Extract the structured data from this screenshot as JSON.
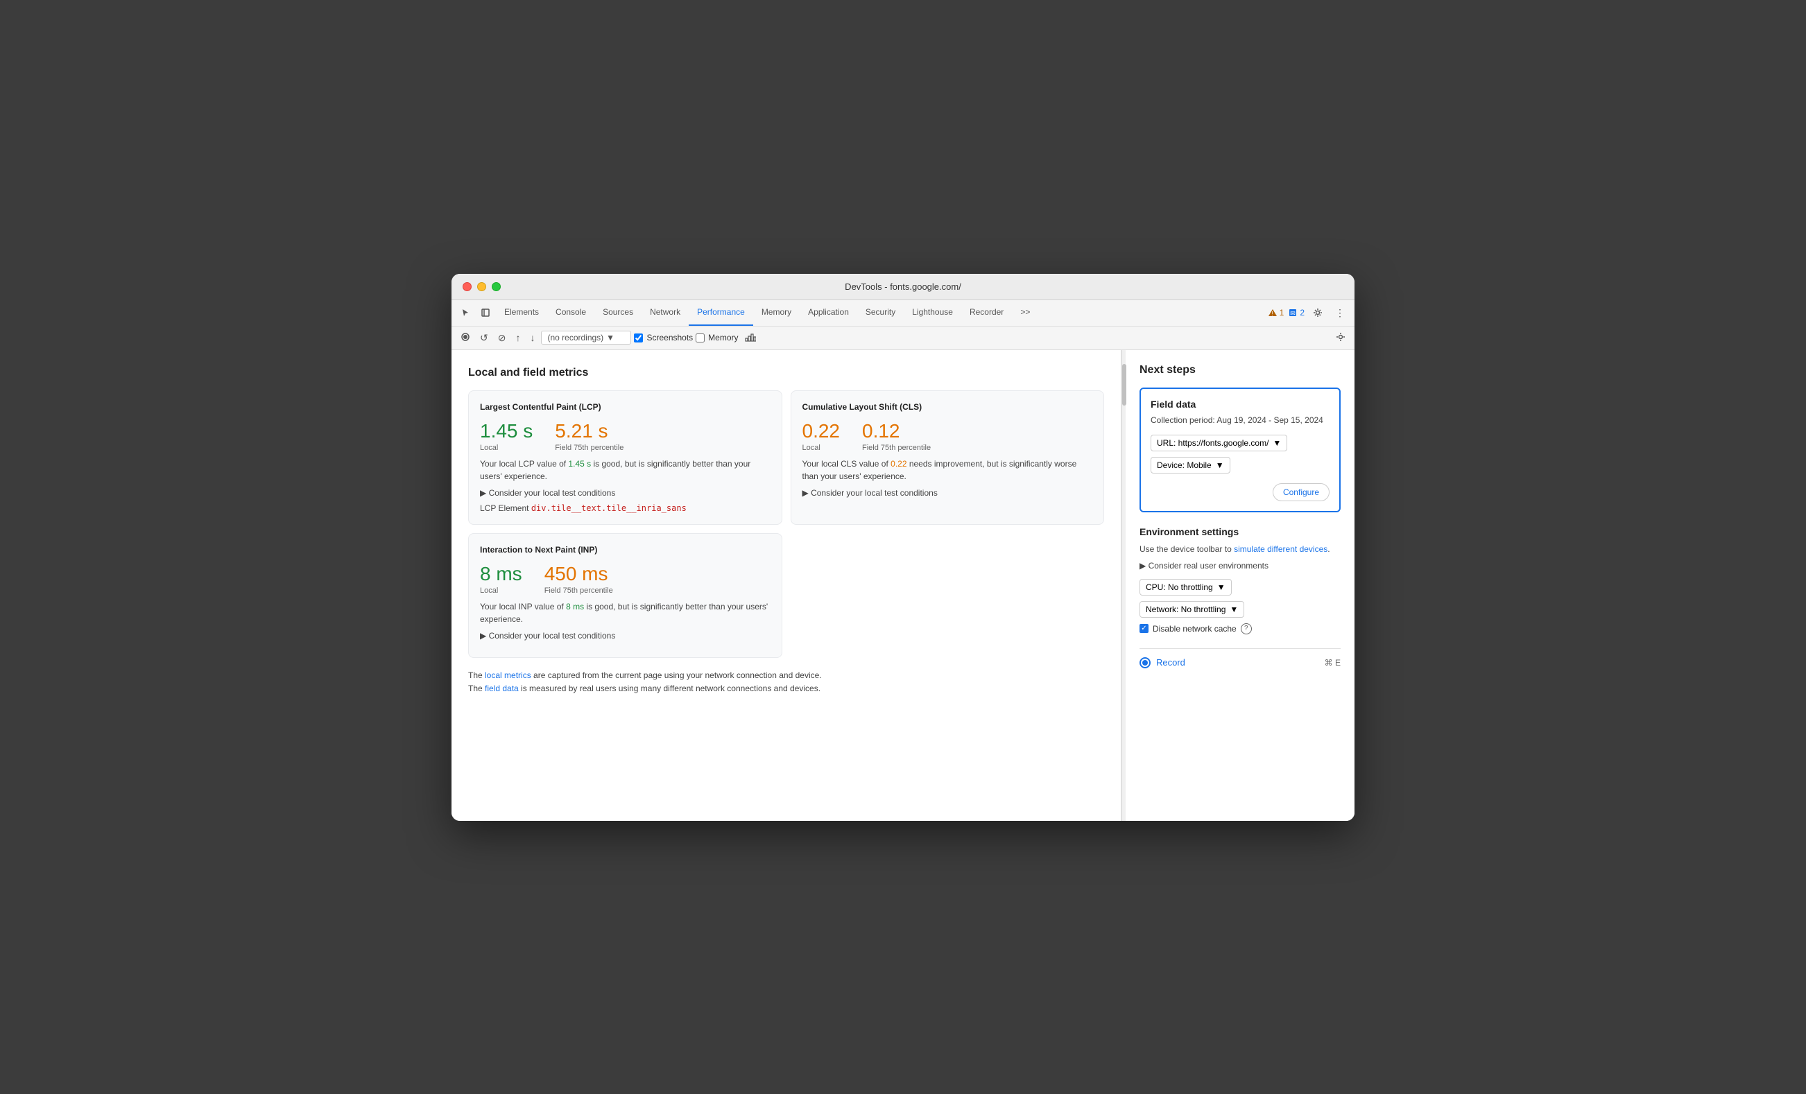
{
  "window": {
    "title": "DevTools - fonts.google.com/"
  },
  "tabs": [
    {
      "id": "elements",
      "label": "Elements",
      "active": false
    },
    {
      "id": "console",
      "label": "Console",
      "active": false
    },
    {
      "id": "sources",
      "label": "Sources",
      "active": false
    },
    {
      "id": "network",
      "label": "Network",
      "active": false
    },
    {
      "id": "performance",
      "label": "Performance",
      "active": true
    },
    {
      "id": "memory",
      "label": "Memory",
      "active": false
    },
    {
      "id": "application",
      "label": "Application",
      "active": false
    },
    {
      "id": "security",
      "label": "Security",
      "active": false
    },
    {
      "id": "lighthouse",
      "label": "Lighthouse",
      "active": false
    },
    {
      "id": "recorder",
      "label": "Recorder",
      "active": false
    }
  ],
  "toolbar_right": {
    "warning_count": "1",
    "info_count": "2"
  },
  "secondary_toolbar": {
    "recording_placeholder": "(no recordings)",
    "screenshots_label": "Screenshots",
    "memory_label": "Memory",
    "screenshots_checked": true,
    "memory_checked": false
  },
  "left_panel": {
    "section_title": "Local and field metrics",
    "lcp_card": {
      "title": "Largest Contentful Paint (LCP)",
      "local_value": "1.45 s",
      "local_label": "Local",
      "field_value": "5.21 s",
      "field_label": "Field 75th percentile",
      "description_prefix": "Your local LCP value of ",
      "description_local": "1.45 s",
      "description_mid": " is good, but is significantly better than your users' experience.",
      "consider_label": "▶ Consider your local test conditions",
      "lcp_element_label": "LCP Element",
      "lcp_element_value": "div.tile__text.tile__inria_sans"
    },
    "cls_card": {
      "title": "Cumulative Layout Shift (CLS)",
      "local_value": "0.22",
      "local_label": "Local",
      "field_value": "0.12",
      "field_label": "Field 75th percentile",
      "description_prefix": "Your local CLS value of ",
      "description_local": "0.22",
      "description_mid": " needs improvement, but is significantly worse than your users' experience.",
      "consider_label": "▶ Consider your local test conditions"
    },
    "inp_card": {
      "title": "Interaction to Next Paint (INP)",
      "local_value": "8 ms",
      "local_label": "Local",
      "field_value": "450 ms",
      "field_label": "Field 75th percentile",
      "description_prefix": "Your local INP value of ",
      "description_local": "8 ms",
      "description_mid": " is good, but is significantly better than your users' experience.",
      "consider_label": "▶ Consider your local test conditions"
    },
    "footer": {
      "line1_prefix": "The ",
      "line1_link": "local metrics",
      "line1_suffix": " are captured from the current page using your network connection and device.",
      "line2_prefix": "The ",
      "line2_link": "field data",
      "line2_suffix": " is measured by real users using many different network connections and devices."
    }
  },
  "right_panel": {
    "title": "Next steps",
    "field_data": {
      "title": "Field data",
      "period": "Collection period: Aug 19, 2024 - Sep 15, 2024",
      "url_label": "URL: https://fonts.google.com/",
      "device_label": "Device: Mobile",
      "configure_label": "Configure"
    },
    "env_settings": {
      "title": "Environment settings",
      "description": "Use the device toolbar to simulate different devices.",
      "link_text": "simulate different devices",
      "consider_label": "▶ Consider real user environments",
      "cpu_label": "CPU: No throttling",
      "network_label": "Network: No throttling",
      "disable_cache_label": "Disable network cache"
    },
    "record": {
      "label": "Record",
      "shortcut": "⌘ E"
    }
  }
}
